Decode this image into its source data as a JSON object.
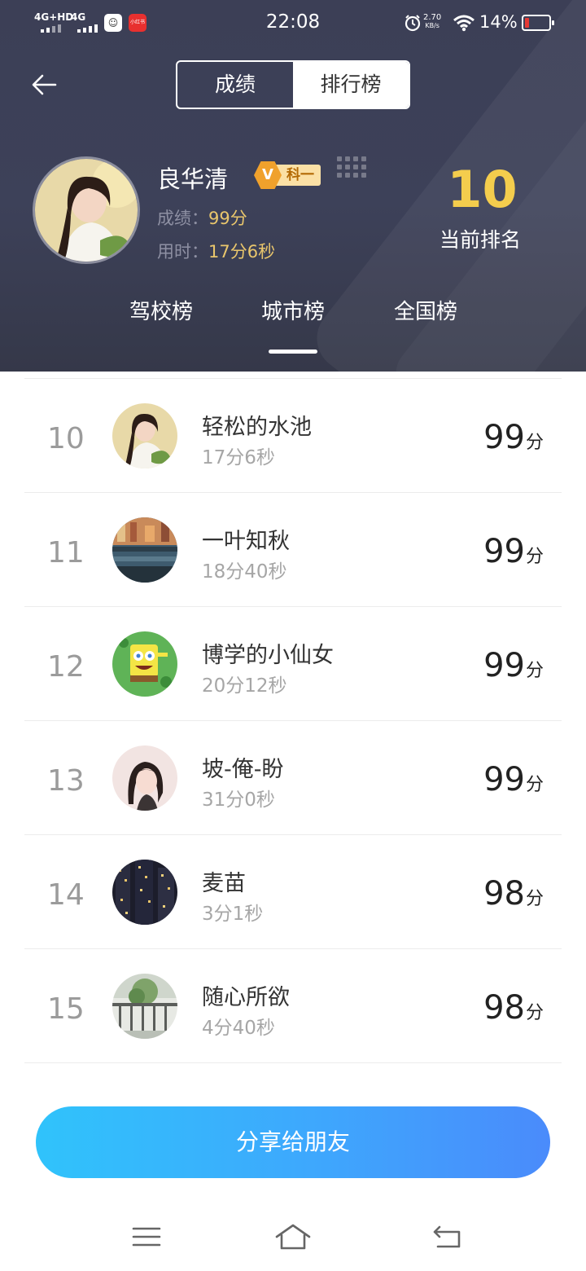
{
  "status_bar": {
    "sig1_label": "4G+HD",
    "sig2_label": "4G",
    "app_icon2": "小红书",
    "time": "22:08",
    "net_speed": "2.70",
    "net_unit": "KB/s",
    "battery": "14%"
  },
  "header": {
    "segment": {
      "left": "成绩",
      "right": "排行榜"
    },
    "user": {
      "name": "良华清",
      "badge": "科一",
      "badge_v": "V",
      "score_label": "成绩：",
      "score_value": "99分",
      "time_label": "用时：",
      "time_value": "17分6秒"
    },
    "rank": {
      "value": "10",
      "label": "当前排名"
    },
    "tabs": [
      "驾校榜",
      "城市榜",
      "全国榜"
    ],
    "active_tab": "城市榜"
  },
  "list": [
    {
      "rank": "10",
      "name": "轻松的水池",
      "time": "17分6秒",
      "score": "99",
      "unit": "分"
    },
    {
      "rank": "11",
      "name": "一叶知秋",
      "time": "18分40秒",
      "score": "99",
      "unit": "分"
    },
    {
      "rank": "12",
      "name": "博学的小仙女",
      "time": "20分12秒",
      "score": "99",
      "unit": "分"
    },
    {
      "rank": "13",
      "name": "坡-俺-盼",
      "time": "31分0秒",
      "score": "99",
      "unit": "分"
    },
    {
      "rank": "14",
      "name": "麦苗",
      "time": "3分1秒",
      "score": "98",
      "unit": "分"
    },
    {
      "rank": "15",
      "name": "随心所欲",
      "time": "4分40秒",
      "score": "98",
      "unit": "分"
    }
  ],
  "share_button": "分享给朋友",
  "icons": {
    "back": "back-arrow-icon",
    "nav_menu": "menu-icon",
    "nav_home": "home-icon",
    "nav_back": "return-icon"
  },
  "colors": {
    "header_bg": "#3d4159",
    "rank_gold": "#f4cd4d",
    "share_start": "#30c3fb",
    "share_end": "#4a8bfb"
  }
}
